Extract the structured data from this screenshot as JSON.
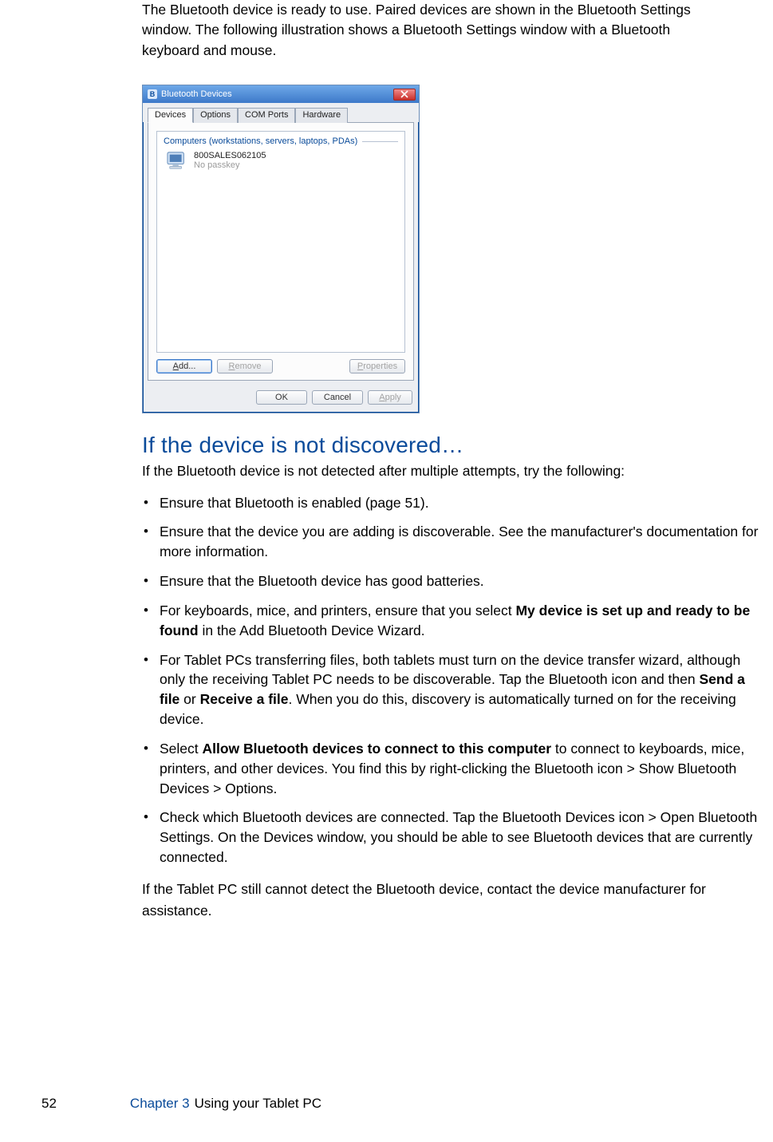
{
  "intro": "The Bluetooth device is ready to use. Paired devices are shown in the Bluetooth Settings window. The following illustration shows a Bluetooth Settings window with a Bluetooth keyboard and mouse.",
  "dialog": {
    "title": "Bluetooth Devices",
    "bt_glyph": "B",
    "tabs": {
      "devices": "Devices",
      "options": "Options",
      "comports": "COM Ports",
      "hardware": "Hardware"
    },
    "group_header": "Computers (workstations, servers, laptops, PDAs)",
    "device": {
      "name": "800SALES062105",
      "sub": "No passkey"
    },
    "buttons": {
      "add_prefix": "A",
      "add_rest": "dd...",
      "remove_prefix": "R",
      "remove_rest": "emove",
      "props_prefix": "P",
      "props_rest": "roperties",
      "ok": "OK",
      "cancel": "Cancel",
      "apply_prefix": "A",
      "apply_rest": "pply"
    }
  },
  "heading": "If the device is not discovered…",
  "subintro": "If the Bluetooth device is not detected after multiple attempts, try the following:",
  "bullets": {
    "b1": "Ensure that Bluetooth is enabled (page 51).",
    "b2": "Ensure that the device you are adding is discoverable. See the manufacturer's documentation for more information.",
    "b3": "Ensure that the Bluetooth device has good batteries.",
    "b4_pre": "For keyboards, mice, and printers, ensure that you select ",
    "b4_bold": "My device is set up and ready to be found",
    "b4_post": " in the Add Bluetooth Device Wizard.",
    "b5_pre": "For Tablet PCs transferring files, both tablets must turn on the device transfer wizard, although only the receiving Tablet PC needs to be discoverable. Tap the Bluetooth icon and then ",
    "b5_bold1": "Send a file",
    "b5_mid": " or ",
    "b5_bold2": "Receive a file",
    "b5_post": ". When you do this, discovery is automatically turned on for the receiving device.",
    "b6_pre": "Select ",
    "b6_bold": "Allow Bluetooth devices to connect to this computer",
    "b6_post": " to connect to keyboards, mice, printers, and other devices. You find this by right-clicking the Bluetooth icon > Show Bluetooth Devices > Options.",
    "b7": "Check which Bluetooth devices are connected. Tap the Bluetooth Devices icon > Open Bluetooth Settings. On the Devices window, you should be able to see Bluetooth devices that are currently connected."
  },
  "closing": "If the Tablet PC still cannot detect the Bluetooth device, contact the device manufacturer for assistance.",
  "footer": {
    "page": "52",
    "chapter": "Chapter 3",
    "title": "Using your Tablet PC"
  }
}
